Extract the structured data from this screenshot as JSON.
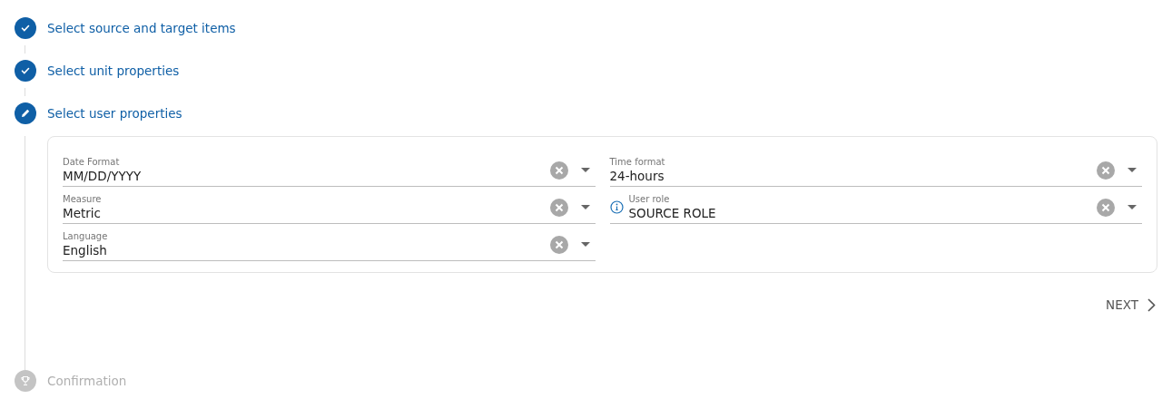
{
  "steps": [
    {
      "label": "Select source and target items",
      "kind": "done"
    },
    {
      "label": "Select unit properties",
      "kind": "done"
    },
    {
      "label": "Select user properties",
      "kind": "editing",
      "form": {
        "columns": [
          [
            {
              "label": "Date Format",
              "value": "MM/DD/YYYY",
              "info": false
            },
            {
              "label": "Measure",
              "value": "Metric",
              "info": false
            },
            {
              "label": "Language",
              "value": "English",
              "info": false
            }
          ],
          [
            {
              "label": "Time format",
              "value": "24-hours",
              "info": false
            },
            {
              "label": "User role",
              "value": "SOURCE ROLE",
              "info": true
            }
          ]
        ]
      },
      "next_button": "NEXT"
    },
    {
      "label": "Confirmation",
      "kind": "pending"
    }
  ]
}
